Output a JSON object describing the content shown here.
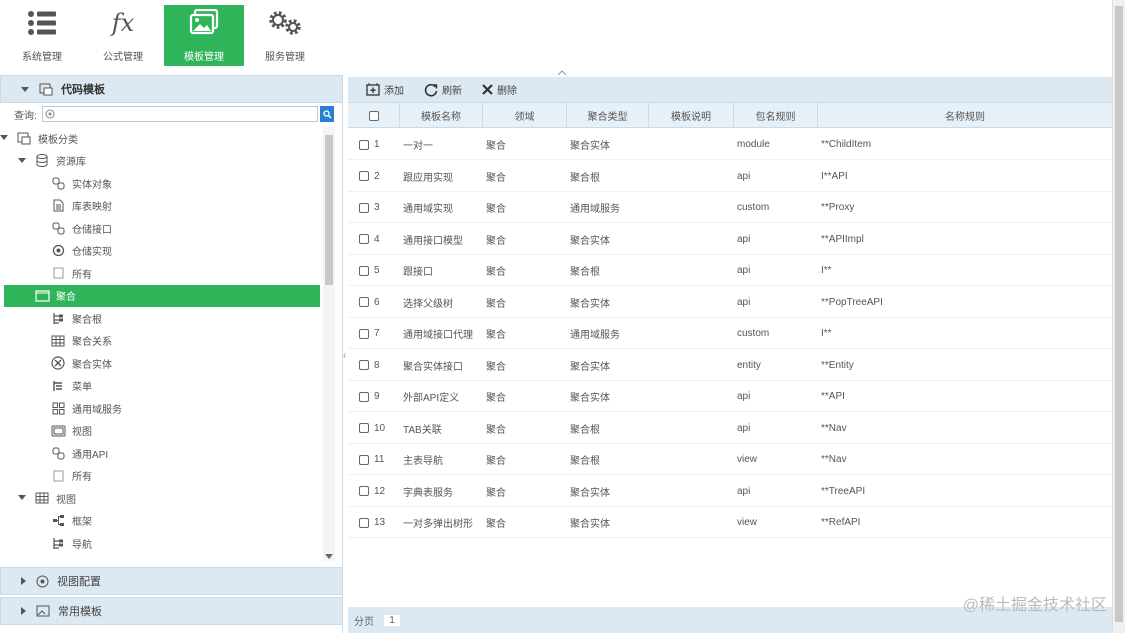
{
  "nav": [
    {
      "label": "系统管理",
      "icon": "list-icon"
    },
    {
      "label": "公式管理",
      "icon": "fx-icon",
      "glyph": "fx"
    },
    {
      "label": "模板管理",
      "icon": "template-icon",
      "active": true
    },
    {
      "label": "服务管理",
      "icon": "gears-icon"
    }
  ],
  "left": {
    "header": "代码模板",
    "search_label": "查询:",
    "search_placeholder": "",
    "tree": [
      {
        "label": "模板分类",
        "icon": "template-category-icon",
        "level": 1,
        "arrow": "down"
      },
      {
        "label": "资源库",
        "icon": "database-icon",
        "level": 2,
        "arrow": "down"
      },
      {
        "label": "实体对象",
        "icon": "link-icon",
        "level": 3
      },
      {
        "label": "库表映射",
        "icon": "document-icon",
        "level": 3
      },
      {
        "label": "仓储接口",
        "icon": "link-icon",
        "level": 3
      },
      {
        "label": "仓储实现",
        "icon": "gear-icon",
        "level": 3
      },
      {
        "label": "所有",
        "icon": "blank-icon",
        "level": 3
      },
      {
        "label": "聚合",
        "icon": "folder-icon",
        "level": 2,
        "arrow": "right",
        "selected": true
      },
      {
        "label": "聚合根",
        "icon": "tree-icon",
        "level": 3
      },
      {
        "label": "聚合关系",
        "icon": "table-icon",
        "level": 3
      },
      {
        "label": "聚合实体",
        "icon": "puzzle-icon",
        "level": 3
      },
      {
        "label": "菜单",
        "icon": "menu-icon",
        "level": 3
      },
      {
        "label": "通用域服务",
        "icon": "grid-icon",
        "level": 3
      },
      {
        "label": "视图",
        "icon": "view-icon",
        "level": 3
      },
      {
        "label": "通用API",
        "icon": "link-icon",
        "level": 3
      },
      {
        "label": "所有",
        "icon": "blank-icon",
        "level": 3
      },
      {
        "label": "视图",
        "icon": "table-icon",
        "level": 2,
        "arrow": "down"
      },
      {
        "label": "框架",
        "icon": "hierarchy-icon",
        "level": 3
      },
      {
        "label": "导航",
        "icon": "tree-icon",
        "level": 3
      }
    ],
    "footer_sections": [
      {
        "label": "视图配置",
        "icon": "target-icon"
      },
      {
        "label": "常用模板",
        "icon": "template-icon"
      }
    ]
  },
  "toolbar": {
    "add": "添加",
    "refresh": "刷新",
    "delete": "删除"
  },
  "grid": {
    "columns": [
      "模板名称",
      "领域",
      "聚合类型",
      "模板说明",
      "包名规则",
      "名称规则"
    ],
    "rows": [
      [
        "1",
        "一对一",
        "聚合",
        "聚合实体",
        "",
        "module",
        "**ChildItem"
      ],
      [
        "2",
        "跟应用实现",
        "聚合",
        "聚合根",
        "",
        "api",
        "I**API"
      ],
      [
        "3",
        "通用域实现",
        "聚合",
        "通用域服务",
        "",
        "custom",
        "**Proxy"
      ],
      [
        "4",
        "通用接口模型",
        "聚合",
        "聚合实体",
        "",
        "api",
        "**APIImpl"
      ],
      [
        "5",
        "跟接口",
        "聚合",
        "聚合根",
        "",
        "api",
        "I**"
      ],
      [
        "6",
        "选择父级树",
        "聚合",
        "聚合实体",
        "",
        "api",
        "**PopTreeAPI"
      ],
      [
        "7",
        "通用域接口代理",
        "聚合",
        "通用域服务",
        "",
        "custom",
        "I**"
      ],
      [
        "8",
        "聚合实体接口",
        "聚合",
        "聚合实体",
        "",
        "entity",
        "**Entity"
      ],
      [
        "9",
        "外部API定义",
        "聚合",
        "聚合实体",
        "",
        "api",
        "**API"
      ],
      [
        "10",
        "TAB关联",
        "聚合",
        "聚合根",
        "",
        "api",
        "**Nav"
      ],
      [
        "11",
        "主表导航",
        "聚合",
        "聚合根",
        "",
        "view",
        "**Nav"
      ],
      [
        "12",
        "字典表服务",
        "聚合",
        "聚合实体",
        "",
        "api",
        "**TreeAPI"
      ],
      [
        "13",
        "一对多弹出树形",
        "聚合",
        "聚合实体",
        "",
        "view",
        "**RefAPI"
      ]
    ]
  },
  "footer": {
    "page_label": "分页",
    "page_number": "1"
  },
  "watermark": "@稀土掘金技术社区",
  "colors": {
    "accent": "#2fb45a",
    "header_bg": "#dce8f2",
    "search_btn": "#2a7fd4"
  }
}
